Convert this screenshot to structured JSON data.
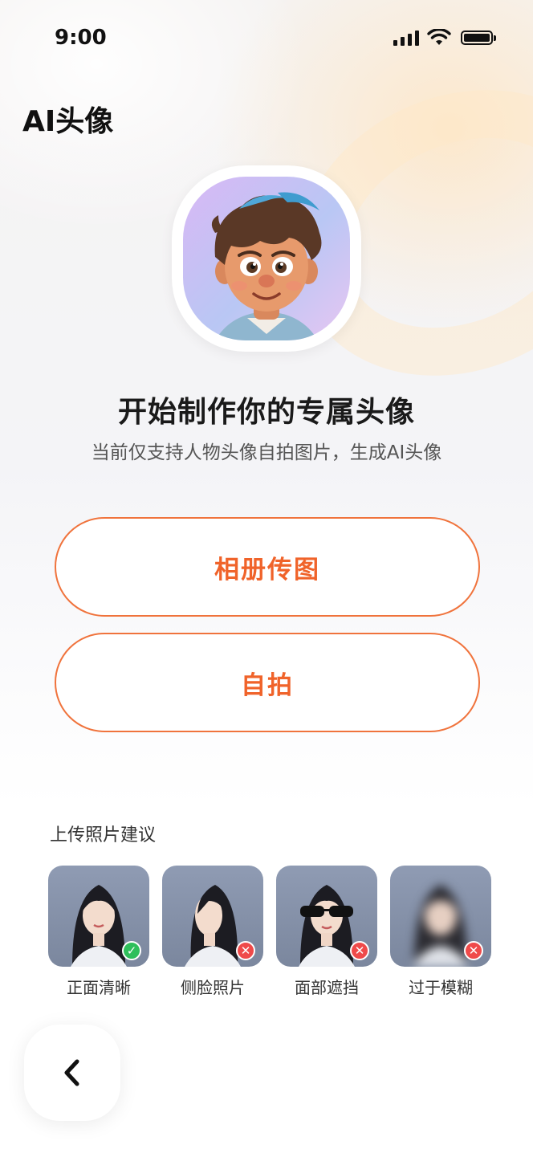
{
  "status_bar": {
    "time": "9:00"
  },
  "page": {
    "title": "AI头像"
  },
  "hero": {
    "headline": "开始制作你的专属头像",
    "subline": "当前仅支持人物头像自拍图片，生成AI头像"
  },
  "actions": {
    "album_label": "相册传图",
    "selfie_label": "自拍"
  },
  "tips": {
    "title": "上传照片建议",
    "items": [
      {
        "label": "正面清晰",
        "status": "ok"
      },
      {
        "label": "侧脸照片",
        "status": "bad"
      },
      {
        "label": "面部遮挡",
        "status": "bad"
      },
      {
        "label": "过于模糊",
        "status": "bad"
      }
    ]
  },
  "colors": {
    "accent": "#f0632a",
    "ok": "#2fbf5b",
    "bad": "#ef4a4a"
  },
  "icons": {
    "back": "chevron-left-icon",
    "ok": "check-icon",
    "bad": "close-icon"
  }
}
